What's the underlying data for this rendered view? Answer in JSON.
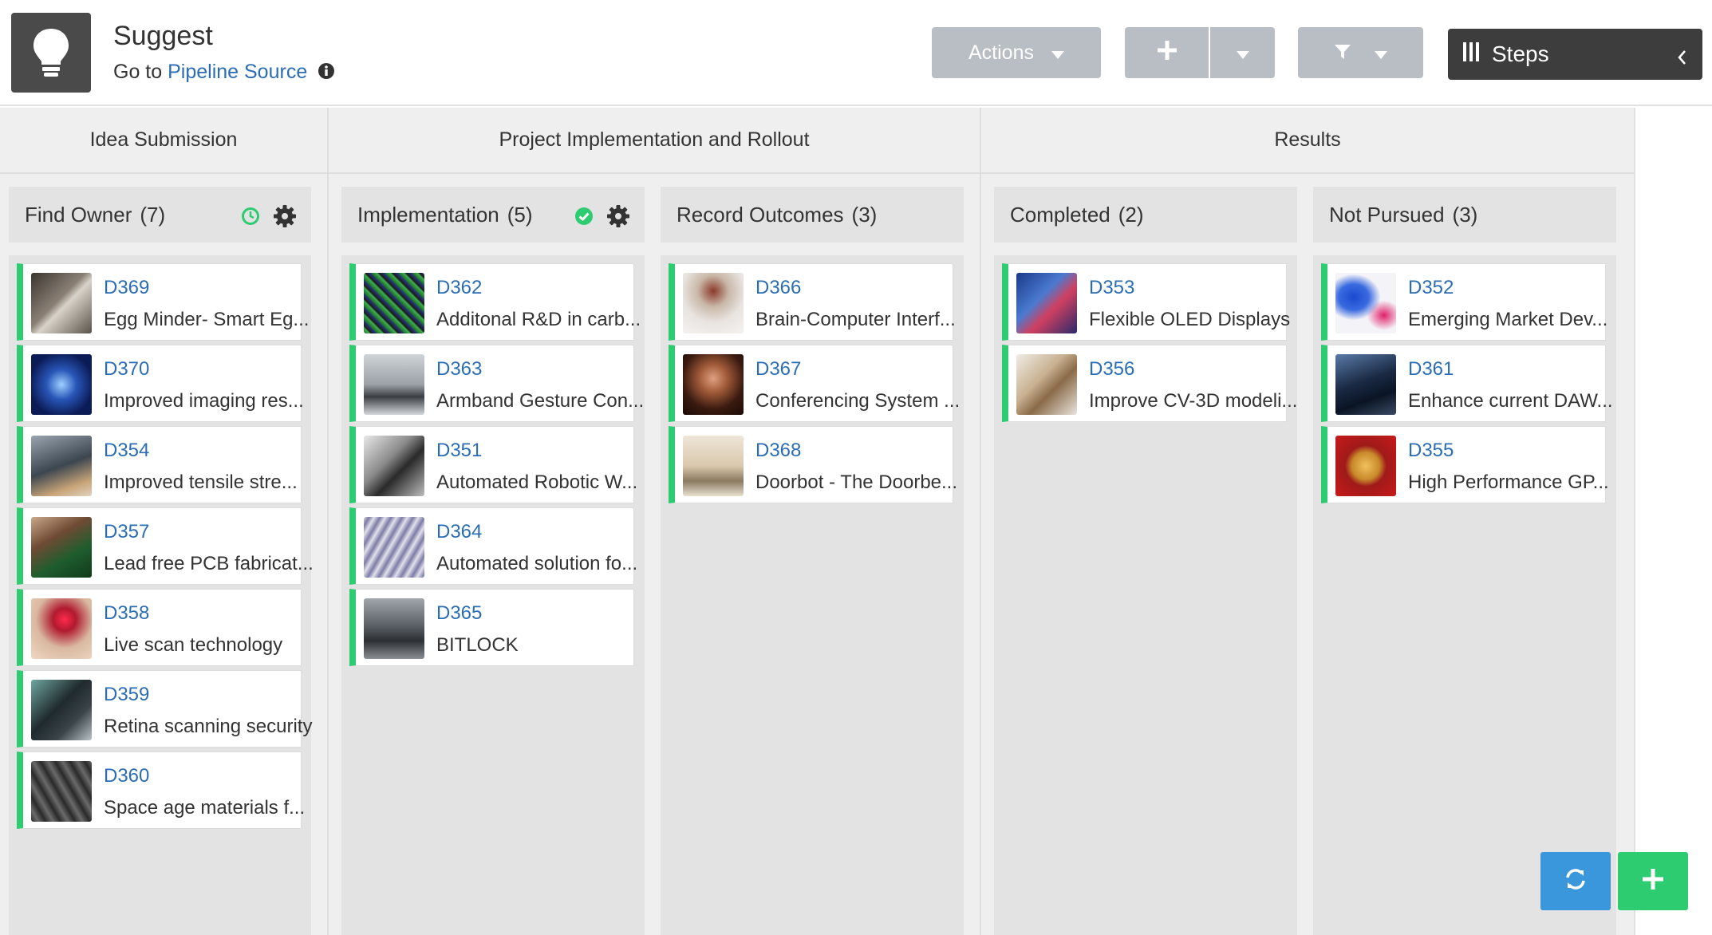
{
  "header": {
    "title": "Suggest",
    "goto_prefix": "Go to",
    "goto_link": "Pipeline Source",
    "actions_label": "Actions",
    "steps_label": "Steps"
  },
  "groups": [
    {
      "label": "Idea Submission"
    },
    {
      "label": "Project Implementation and Rollout"
    },
    {
      "label": "Results"
    }
  ],
  "stages": [
    {
      "name": "Find Owner",
      "count": "(7)",
      "cards": [
        {
          "id": "D369",
          "title": "Egg Minder- Smart Eg..."
        },
        {
          "id": "D370",
          "title": "Improved imaging res..."
        },
        {
          "id": "D354",
          "title": "Improved tensile stre..."
        },
        {
          "id": "D357",
          "title": "Lead free PCB fabricat..."
        },
        {
          "id": "D358",
          "title": "Live scan technology"
        },
        {
          "id": "D359",
          "title": "Retina scanning security"
        },
        {
          "id": "D360",
          "title": "Space age materials f..."
        }
      ]
    },
    {
      "name": "Implementation",
      "count": "(5)",
      "cards": [
        {
          "id": "D362",
          "title": "Additonal R&D in carb..."
        },
        {
          "id": "D363",
          "title": "Armband Gesture Con..."
        },
        {
          "id": "D351",
          "title": "Automated Robotic W..."
        },
        {
          "id": "D364",
          "title": "Automated solution fo..."
        },
        {
          "id": "D365",
          "title": "BITLOCK"
        }
      ]
    },
    {
      "name": "Record Outcomes",
      "count": "(3)",
      "cards": [
        {
          "id": "D366",
          "title": "Brain-Computer Interf..."
        },
        {
          "id": "D367",
          "title": "Conferencing System ..."
        },
        {
          "id": "D368",
          "title": "Doorbot - The Doorbe..."
        }
      ]
    },
    {
      "name": "Completed",
      "count": "(2)",
      "cards": [
        {
          "id": "D353",
          "title": "Flexible OLED Displays"
        },
        {
          "id": "D356",
          "title": "Improve CV-3D modeli..."
        }
      ]
    },
    {
      "name": "Not Pursued",
      "count": "(3)",
      "cards": [
        {
          "id": "D352",
          "title": "Emerging Market Dev..."
        },
        {
          "id": "D361",
          "title": "Enhance current DAW..."
        },
        {
          "id": "D355",
          "title": "High Performance GP..."
        }
      ]
    }
  ],
  "colors": {
    "accent_green": "#2ecc71",
    "link_blue": "#2a6db5",
    "refresh_blue": "#3a97dc",
    "button_gray": "#b9bec4",
    "dark": "#3d3d3d"
  }
}
